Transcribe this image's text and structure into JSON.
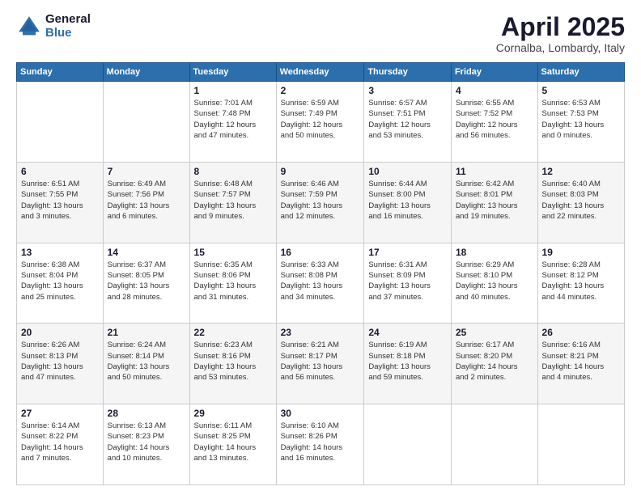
{
  "header": {
    "logo_general": "General",
    "logo_blue": "Blue",
    "month_title": "April 2025",
    "location": "Cornalba, Lombardy, Italy"
  },
  "calendar": {
    "days_of_week": [
      "Sunday",
      "Monday",
      "Tuesday",
      "Wednesday",
      "Thursday",
      "Friday",
      "Saturday"
    ],
    "weeks": [
      [
        {
          "day": "",
          "detail": ""
        },
        {
          "day": "",
          "detail": ""
        },
        {
          "day": "1",
          "detail": "Sunrise: 7:01 AM\nSunset: 7:48 PM\nDaylight: 12 hours\nand 47 minutes."
        },
        {
          "day": "2",
          "detail": "Sunrise: 6:59 AM\nSunset: 7:49 PM\nDaylight: 12 hours\nand 50 minutes."
        },
        {
          "day": "3",
          "detail": "Sunrise: 6:57 AM\nSunset: 7:51 PM\nDaylight: 12 hours\nand 53 minutes."
        },
        {
          "day": "4",
          "detail": "Sunrise: 6:55 AM\nSunset: 7:52 PM\nDaylight: 12 hours\nand 56 minutes."
        },
        {
          "day": "5",
          "detail": "Sunrise: 6:53 AM\nSunset: 7:53 PM\nDaylight: 13 hours\nand 0 minutes."
        }
      ],
      [
        {
          "day": "6",
          "detail": "Sunrise: 6:51 AM\nSunset: 7:55 PM\nDaylight: 13 hours\nand 3 minutes."
        },
        {
          "day": "7",
          "detail": "Sunrise: 6:49 AM\nSunset: 7:56 PM\nDaylight: 13 hours\nand 6 minutes."
        },
        {
          "day": "8",
          "detail": "Sunrise: 6:48 AM\nSunset: 7:57 PM\nDaylight: 13 hours\nand 9 minutes."
        },
        {
          "day": "9",
          "detail": "Sunrise: 6:46 AM\nSunset: 7:59 PM\nDaylight: 13 hours\nand 12 minutes."
        },
        {
          "day": "10",
          "detail": "Sunrise: 6:44 AM\nSunset: 8:00 PM\nDaylight: 13 hours\nand 16 minutes."
        },
        {
          "day": "11",
          "detail": "Sunrise: 6:42 AM\nSunset: 8:01 PM\nDaylight: 13 hours\nand 19 minutes."
        },
        {
          "day": "12",
          "detail": "Sunrise: 6:40 AM\nSunset: 8:03 PM\nDaylight: 13 hours\nand 22 minutes."
        }
      ],
      [
        {
          "day": "13",
          "detail": "Sunrise: 6:38 AM\nSunset: 8:04 PM\nDaylight: 13 hours\nand 25 minutes."
        },
        {
          "day": "14",
          "detail": "Sunrise: 6:37 AM\nSunset: 8:05 PM\nDaylight: 13 hours\nand 28 minutes."
        },
        {
          "day": "15",
          "detail": "Sunrise: 6:35 AM\nSunset: 8:06 PM\nDaylight: 13 hours\nand 31 minutes."
        },
        {
          "day": "16",
          "detail": "Sunrise: 6:33 AM\nSunset: 8:08 PM\nDaylight: 13 hours\nand 34 minutes."
        },
        {
          "day": "17",
          "detail": "Sunrise: 6:31 AM\nSunset: 8:09 PM\nDaylight: 13 hours\nand 37 minutes."
        },
        {
          "day": "18",
          "detail": "Sunrise: 6:29 AM\nSunset: 8:10 PM\nDaylight: 13 hours\nand 40 minutes."
        },
        {
          "day": "19",
          "detail": "Sunrise: 6:28 AM\nSunset: 8:12 PM\nDaylight: 13 hours\nand 44 minutes."
        }
      ],
      [
        {
          "day": "20",
          "detail": "Sunrise: 6:26 AM\nSunset: 8:13 PM\nDaylight: 13 hours\nand 47 minutes."
        },
        {
          "day": "21",
          "detail": "Sunrise: 6:24 AM\nSunset: 8:14 PM\nDaylight: 13 hours\nand 50 minutes."
        },
        {
          "day": "22",
          "detail": "Sunrise: 6:23 AM\nSunset: 8:16 PM\nDaylight: 13 hours\nand 53 minutes."
        },
        {
          "day": "23",
          "detail": "Sunrise: 6:21 AM\nSunset: 8:17 PM\nDaylight: 13 hours\nand 56 minutes."
        },
        {
          "day": "24",
          "detail": "Sunrise: 6:19 AM\nSunset: 8:18 PM\nDaylight: 13 hours\nand 59 minutes."
        },
        {
          "day": "25",
          "detail": "Sunrise: 6:17 AM\nSunset: 8:20 PM\nDaylight: 14 hours\nand 2 minutes."
        },
        {
          "day": "26",
          "detail": "Sunrise: 6:16 AM\nSunset: 8:21 PM\nDaylight: 14 hours\nand 4 minutes."
        }
      ],
      [
        {
          "day": "27",
          "detail": "Sunrise: 6:14 AM\nSunset: 8:22 PM\nDaylight: 14 hours\nand 7 minutes."
        },
        {
          "day": "28",
          "detail": "Sunrise: 6:13 AM\nSunset: 8:23 PM\nDaylight: 14 hours\nand 10 minutes."
        },
        {
          "day": "29",
          "detail": "Sunrise: 6:11 AM\nSunset: 8:25 PM\nDaylight: 14 hours\nand 13 minutes."
        },
        {
          "day": "30",
          "detail": "Sunrise: 6:10 AM\nSunset: 8:26 PM\nDaylight: 14 hours\nand 16 minutes."
        },
        {
          "day": "",
          "detail": ""
        },
        {
          "day": "",
          "detail": ""
        },
        {
          "day": "",
          "detail": ""
        }
      ]
    ]
  }
}
